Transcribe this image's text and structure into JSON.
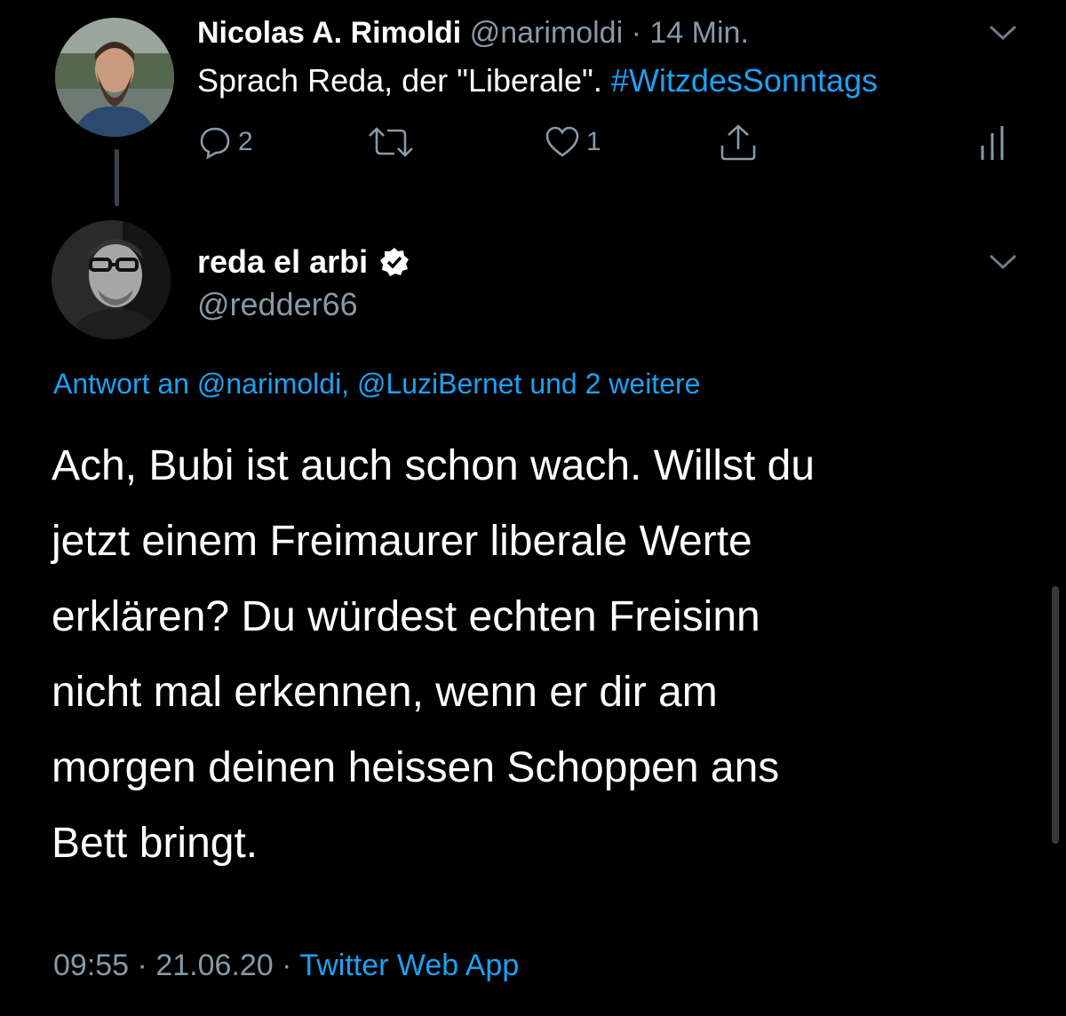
{
  "parent_tweet": {
    "author_name": "Nicolas A. Rimoldi",
    "handle": "@narimoldi",
    "separator": "·",
    "time_ago": "14 Min.",
    "text_plain": "Sprach Reda, der \"Liberale\".",
    "hashtag": "#WitzdesSonntags",
    "reply_count": "2",
    "retweet_count": "",
    "like_count": "1"
  },
  "main_tweet": {
    "author_name": "reda el arbi",
    "handle": "@redder66",
    "reply_context": "Antwort an @narimoldi, @LuziBernet und 2 weitere",
    "text_lines": [
      "Ach, Bubi ist auch schon wach. Willst du",
      "jetzt einem Freimaurer liberale Werte",
      "erklären? Du würdest echten Freisinn",
      "nicht mal erkennen, wenn er dir am",
      "morgen deinen heissen Schoppen ans",
      "Bett bringt."
    ],
    "time": "09:55",
    "date": "21.06.20",
    "separator": "·",
    "source": "Twitter Web App"
  },
  "icons": {
    "reply": "reply-icon",
    "retweet": "retweet-icon",
    "like": "like-icon",
    "share": "share-icon",
    "analytics": "analytics-icon",
    "verified": "verified-badge-icon",
    "more": "chevron-down-icon"
  },
  "colors": {
    "background": "#000000",
    "text": "#ffffff",
    "secondary": "#8899a6",
    "accent": "#1da1f2",
    "thread_line": "#38444d"
  }
}
